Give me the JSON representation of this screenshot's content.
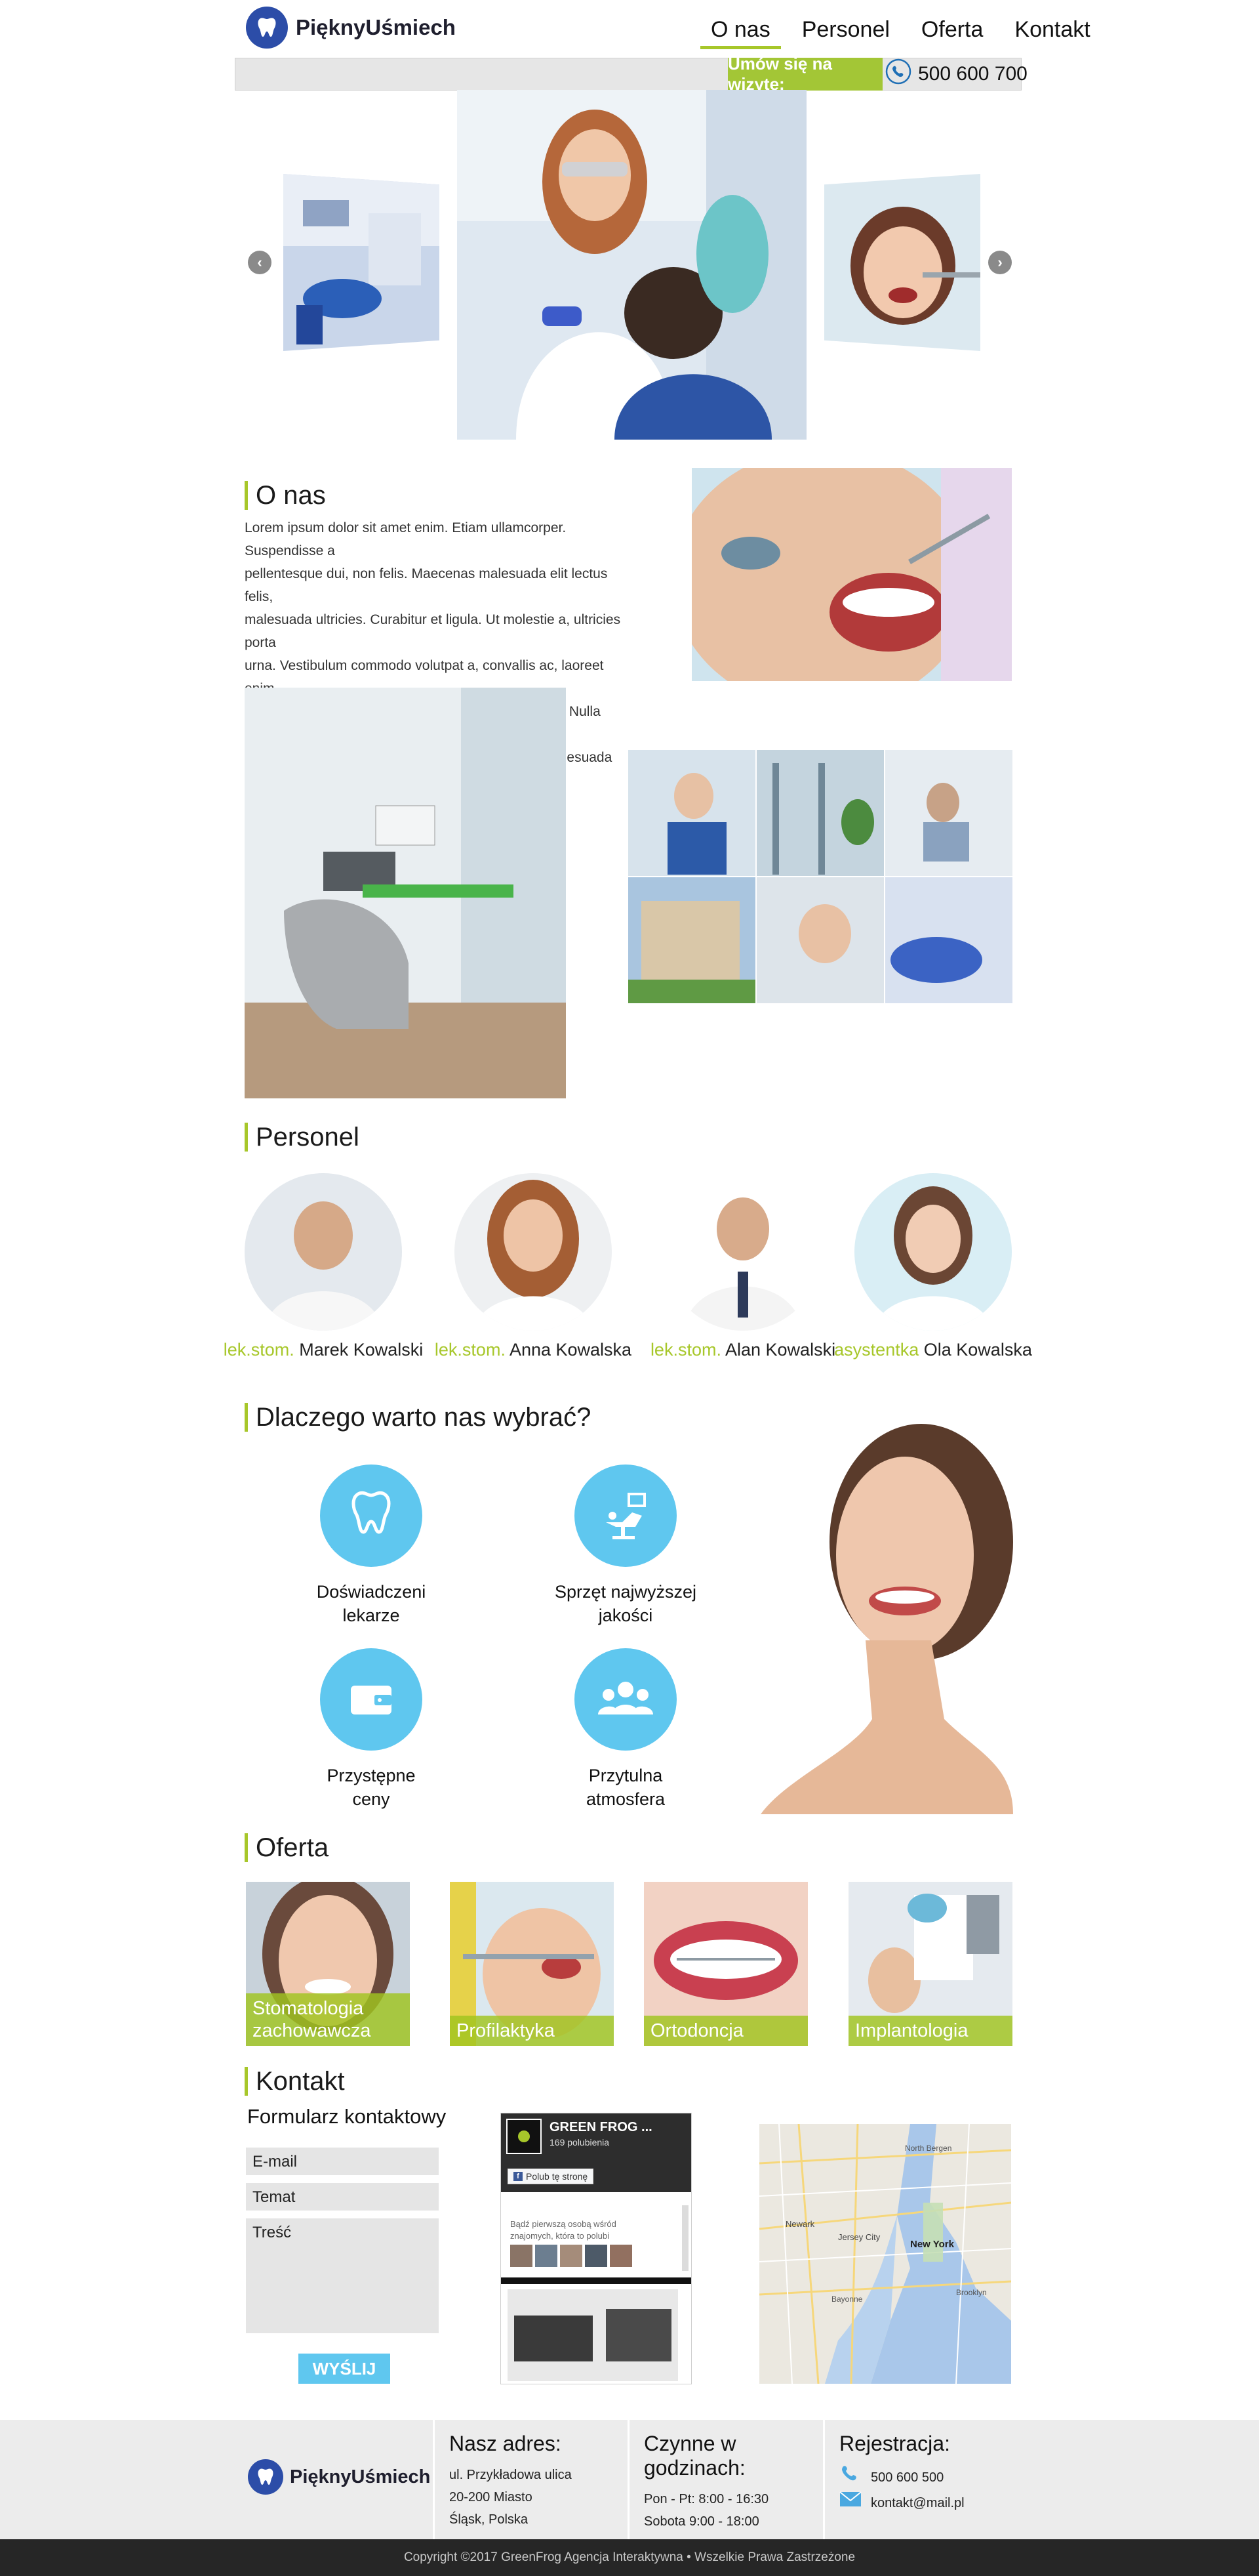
{
  "brand": {
    "name": "PięknyUśmiech",
    "logo_icon": "tooth-icon"
  },
  "nav": [
    {
      "label": "O nas",
      "active": true
    },
    {
      "label": "Personel",
      "active": false
    },
    {
      "label": "Oferta",
      "active": false
    },
    {
      "label": "Kontakt",
      "active": false
    }
  ],
  "topbar": {
    "appointment": "Umów się na wizytę:",
    "phone": "500 600 700",
    "phone_icon": "phone-icon"
  },
  "slider": {
    "prev_icon": "chevron-left-icon",
    "next_icon": "chevron-right-icon"
  },
  "about": {
    "heading": "O nas",
    "lines": [
      "Lorem ipsum dolor sit amet enim. Etiam ullamcorper. Suspendisse a",
      "pellentesque dui, non felis. Maecenas malesuada elit lectus felis,",
      "malesuada ultricies. Curabitur et ligula. Ut molestie a, ultricies porta",
      "urna. Vestibulum commodo volutpat a, convallis ac, laoreet enim.",
      "Phasellus fermentum in, dolor. Pellentesque facilisis. Nulla imperdiet",
      "sit amet magna. Vestibulum dapibus, mauris nec malesuada fames ac"
    ]
  },
  "staff": {
    "heading": "Personel",
    "members": [
      {
        "role": "lek.stom.",
        "name": "Marek Kowalski"
      },
      {
        "role": "lek.stom.",
        "name": "Anna Kowalska"
      },
      {
        "role": "lek.stom.",
        "name": "Alan Kowalski"
      },
      {
        "role": "asystentka",
        "name": "Ola Kowalska"
      }
    ]
  },
  "why": {
    "heading": "Dlaczego warto nas wybrać?",
    "items": [
      {
        "line1": "Doświadczeni",
        "line2": "lekarze",
        "icon": "tooth-icon"
      },
      {
        "line1": "Sprzęt najwyższej",
        "line2": "jakości",
        "icon": "dental-chair-icon"
      },
      {
        "line1": "Przystępne",
        "line2": "ceny",
        "icon": "wallet-icon"
      },
      {
        "line1": "Przytulna",
        "line2": "atmosfera",
        "icon": "people-icon"
      }
    ]
  },
  "offer": {
    "heading": "Oferta",
    "items": [
      {
        "line1": "Stomatologia",
        "line2": "zachowawcza"
      },
      {
        "line1": "Profilaktyka",
        "line2": ""
      },
      {
        "line1": "Ortodoncja",
        "line2": ""
      },
      {
        "line1": "Implantologia",
        "line2": ""
      }
    ]
  },
  "contact": {
    "heading": "Kontakt",
    "form_title": "Formularz kontaktowy",
    "email_placeholder": "E-mail",
    "subject_placeholder": "Temat",
    "message_placeholder": "Treść",
    "send": "WYŚLIJ",
    "fb": {
      "page_name": "GREEN FROG ...",
      "likes": "169 polubienia",
      "like_button": "Polub tę stronę",
      "invite_line1": "Bądź pierwszą osobą wśród",
      "invite_line2": "znajomych, która to polubi"
    },
    "map_labels": [
      "North Bergen",
      "Newark",
      "Jersey City",
      "New York",
      "Bayonne",
      "Brooklyn"
    ]
  },
  "footer": {
    "address_head": "Nasz adres:",
    "address": [
      "ul. Przykładowa ulica",
      "20-200 Miasto",
      "Śląsk, Polska"
    ],
    "hours_head": "Czynne w godzinach:",
    "hours": [
      "Pon - Pt: 8:00 - 16:30",
      "Sobota 9:00 - 18:00"
    ],
    "reg_head": "Rejestracja:",
    "reg_phone": "500 600 500",
    "reg_email": "kontakt@mail.pl",
    "copyright": "Copyright ©2017 GreenFrog Agencja Interaktywna • Wszelkie Prawa Zastrzeżone"
  },
  "colors": {
    "accent_green": "#a7c72a",
    "accent_blue": "#5fc7ef",
    "logo_blue": "#2c4da8",
    "footer_dark": "#262626"
  }
}
